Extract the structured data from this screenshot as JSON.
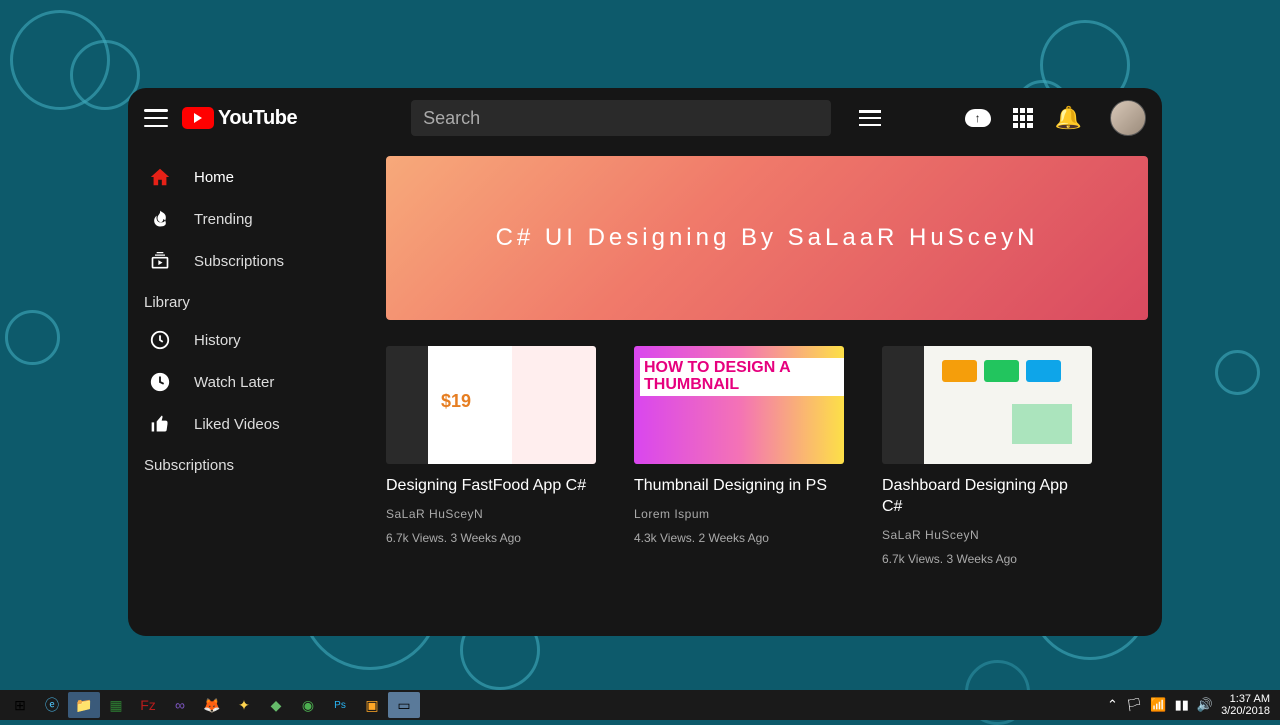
{
  "brand": "YouTube",
  "search": {
    "placeholder": "Search"
  },
  "sidebar": {
    "items": [
      {
        "label": "Home"
      },
      {
        "label": "Trending"
      },
      {
        "label": "Subscriptions"
      }
    ],
    "library_header": "Library",
    "library_items": [
      {
        "label": "History"
      },
      {
        "label": "Watch Later"
      },
      {
        "label": "Liked Videos"
      }
    ],
    "subscriptions_header": "Subscriptions"
  },
  "banner": {
    "title": "C# UI Designing By SaLaaR HuSceyN"
  },
  "videos": [
    {
      "title": "Designing FastFood App C#",
      "author": "SaLaR HuSceyN",
      "meta": "6.7k Views. 3 Weeks Ago"
    },
    {
      "title": "Thumbnail Designing in PS",
      "author": "Lorem Ispum",
      "meta": "4.3k Views. 2 Weeks Ago",
      "thumb_text": "HOW TO\nDESIGN A\nTHUMBNAIL"
    },
    {
      "title": "Dashboard Designing App C#",
      "author": "SaLaR HuSceyN",
      "meta": "6.7k Views. 3 Weeks Ago"
    }
  ],
  "taskbar": {
    "time": "1:37 AM",
    "date": "3/20/2018"
  }
}
